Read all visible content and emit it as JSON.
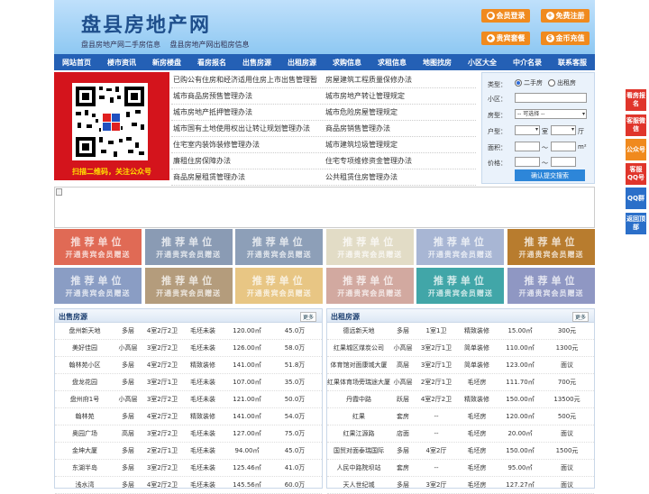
{
  "header": {
    "logo": "盘县房地产网",
    "sub_links": [
      "盘县房地产网二手房信息",
      "盘县房地产网出租房信息"
    ],
    "buttons": [
      {
        "icon": "user-icon",
        "label": "会员登录"
      },
      {
        "icon": "person-add-icon",
        "label": "免费注册"
      },
      {
        "icon": "package-icon",
        "label": "贵宾套餐"
      },
      {
        "icon": "coin-icon",
        "label": "金币充值"
      }
    ]
  },
  "nav": [
    "网站首页",
    "楼市资讯",
    "新房楼盘",
    "看房报名",
    "出售房源",
    "出租房源",
    "求购信息",
    "求租信息",
    "地图找房",
    "小区大全",
    "中介名录",
    "联系客服"
  ],
  "qr": {
    "caption": "扫描二维码，关注公众号"
  },
  "news": [
    [
      "已购公有住房和经济适用住房上市出售管理暂",
      "房屋建筑工程质量保修办法"
    ],
    [
      "城市商品房预售管理办法",
      "城市房地产转让管理规定"
    ],
    [
      "城市房地产抵押管理办法",
      "城市危险房屋管理规定"
    ],
    [
      "城市国有土地使用权出让转让规划管理办法",
      "商品房销售管理办法"
    ],
    [
      "住宅室内装饰装修管理办法",
      "城市建筑垃圾管理规定"
    ],
    [
      "廉租住房保障办法",
      "住宅专项维修资金管理办法"
    ],
    [
      "商品房屋租赁管理办法",
      "公共租赁住房管理办法"
    ]
  ],
  "search": {
    "type_label": "类型：",
    "opt1": "二手房",
    "opt2": "出租房",
    "community_label": "小区：",
    "house_type_label": "房型：",
    "house_type_value": "-- 可选择 --",
    "layout_label": "户型：",
    "room_unit": "室",
    "hall_unit": "厅",
    "area_label": "面积：",
    "area_unit": "m²",
    "price_label": "价格：",
    "tilde": "～",
    "submit": "确认提交搜索"
  },
  "tiles": {
    "line1": "推荐单位",
    "line2": "开通贵宾会员赠送",
    "colors": [
      "#e06a55",
      "#8a9bb4",
      "#8d9fb8",
      "#e2dcc6",
      "#a8b6d4",
      "#b87c2e",
      "#8a9dc4",
      "#b49c7c",
      "#e8c684",
      "#d2a9a0",
      "#41a6a8",
      "#8f97c3"
    ]
  },
  "sale": {
    "title": "出售房源",
    "more": "更多",
    "rows": [
      [
        "盘州新天地",
        "多层",
        "4室2厅2卫",
        "毛坯未装",
        "120.00㎡",
        "45.0万"
      ],
      [
        "美好佳园",
        "小高层",
        "3室2厅2卫",
        "毛坯未装",
        "126.00㎡",
        "58.0万"
      ],
      [
        "翰林苑小区",
        "多层",
        "4室2厅2卫",
        "精致装修",
        "141.00㎡",
        "51.8万"
      ],
      [
        "盘龙花园",
        "多层",
        "3室2厅1卫",
        "毛坯未装",
        "107.00㎡",
        "35.0万"
      ],
      [
        "盘州府1号",
        "小高层",
        "3室2厅2卫",
        "毛坯未装",
        "121.00㎡",
        "50.0万"
      ],
      [
        "翰林苑",
        "多层",
        "4室2厅2卫",
        "精致装修",
        "141.00㎡",
        "54.0万"
      ],
      [
        "奥园广场",
        "高层",
        "3室2厅2卫",
        "毛坯未装",
        "127.00㎡",
        "75.0万"
      ],
      [
        "金坤大厦",
        "多层",
        "2室2厅1卫",
        "毛坯未装",
        "94.00㎡",
        "45.0万"
      ],
      [
        "东湖半岛",
        "多层",
        "3室2厅2卫",
        "毛坯未装",
        "125.46㎡",
        "41.0万"
      ],
      [
        "浅水湾",
        "多层",
        "4室2厅2卫",
        "毛坯未装",
        "145.56㎡",
        "60.0万"
      ]
    ]
  },
  "rent": {
    "title": "出租房源",
    "more": "更多",
    "rows": [
      [
        "德远新天地",
        "多层",
        "1室1卫",
        "精致装修",
        "15.00㎡",
        "300元"
      ],
      [
        "红果城区煤炭公司",
        "小高层",
        "3室2厅1卫",
        "简单装修",
        "110.00㎡",
        "1300元"
      ],
      [
        "体育馆对面康城大厦",
        "高层",
        "3室2厅1卫",
        "简单装修",
        "123.00㎡",
        "面议"
      ],
      [
        "红果体育场旁瑞途大厦",
        "小高层",
        "2室2厅1卫",
        "毛坯房",
        "111.70㎡",
        "700元"
      ],
      [
        "丹霞中路",
        "跃层",
        "4室2厅2卫",
        "精致装修",
        "150.00㎡",
        "13500元"
      ],
      [
        "红果",
        "套房",
        "--",
        "毛坯房",
        "120.00㎡",
        "500元"
      ],
      [
        "红果江源路",
        "店面",
        "--",
        "毛坯房",
        "20.00㎡",
        "面议"
      ],
      [
        "国贸对面泰瑞国际",
        "多层",
        "4室2厅",
        "毛坯房",
        "150.00㎡",
        "1500元"
      ],
      [
        "人民中路院坝站",
        "套房",
        "--",
        "毛坯房",
        "95.00㎡",
        "面议"
      ],
      [
        "天人世纪城",
        "多层",
        "3室2厅",
        "毛坯房",
        "127.27㎡",
        "面议"
      ]
    ]
  },
  "sidebar": [
    "看房报名",
    "客服微信",
    "公众号",
    "客服QQ号",
    "QQ群",
    "返回顶部"
  ]
}
